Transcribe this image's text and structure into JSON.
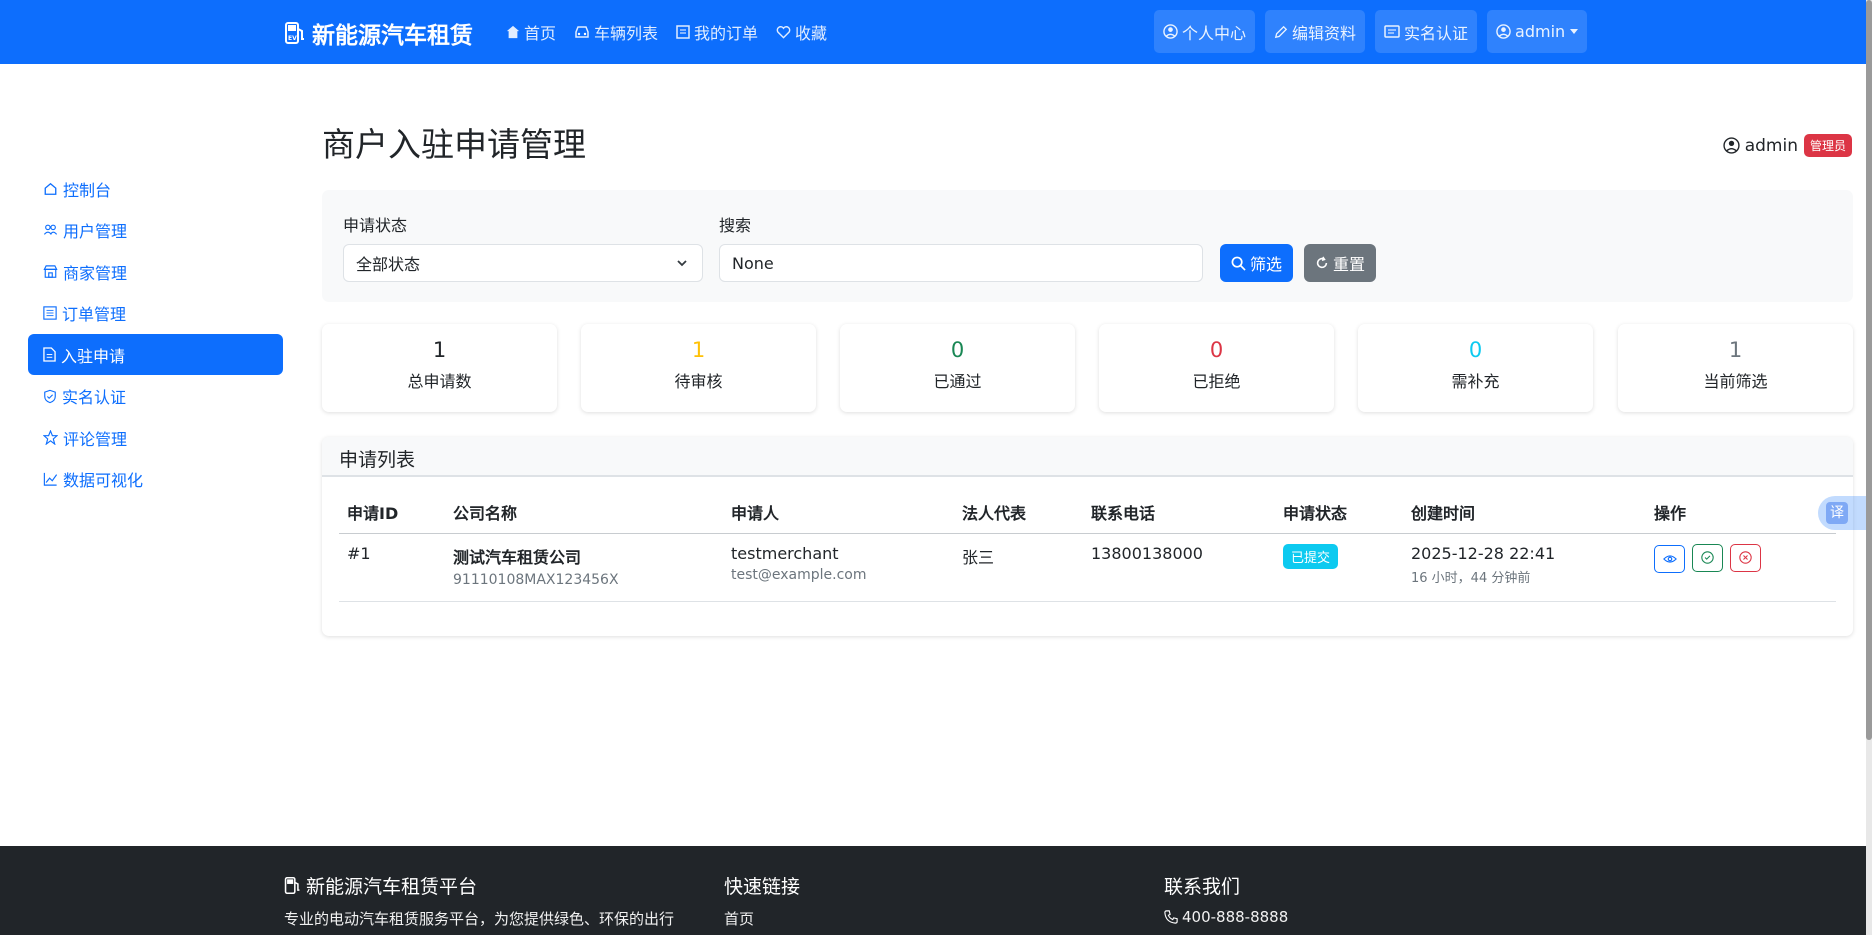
{
  "navbar": {
    "brand": "新能源汽车租赁",
    "links": [
      {
        "label": "首页",
        "icon": "house-icon"
      },
      {
        "label": "车辆列表",
        "icon": "car-icon"
      },
      {
        "label": "我的订单",
        "icon": "receipt-icon"
      },
      {
        "label": "收藏",
        "icon": "heart-icon"
      }
    ],
    "right": [
      {
        "label": "个人中心",
        "icon": "person-circle-icon"
      },
      {
        "label": "编辑资料",
        "icon": "pencil-icon"
      },
      {
        "label": "实名认证",
        "icon": "card-icon"
      }
    ],
    "user_menu": "admin"
  },
  "sidebar": {
    "items": [
      {
        "label": "控制台",
        "icon": "house-icon"
      },
      {
        "label": "用户管理",
        "icon": "people-icon"
      },
      {
        "label": "商家管理",
        "icon": "shop-icon"
      },
      {
        "label": "订单管理",
        "icon": "list-icon"
      },
      {
        "label": "入驻申请",
        "icon": "document-icon",
        "active": true
      },
      {
        "label": "实名认证",
        "icon": "shield-icon"
      },
      {
        "label": "评论管理",
        "icon": "star-icon"
      },
      {
        "label": "数据可视化",
        "icon": "chart-icon"
      }
    ]
  },
  "page": {
    "title": "商户入驻申请管理",
    "user": "admin",
    "role": "管理员"
  },
  "filters": {
    "status_label": "申请状态",
    "status_value": "全部状态",
    "search_label": "搜索",
    "search_value": "None",
    "filter_button": "筛选",
    "reset_button": "重置"
  },
  "stats": [
    {
      "value": "1",
      "label": "总申请数",
      "color": "#212529"
    },
    {
      "value": "1",
      "label": "待审核",
      "color": "#ffc107"
    },
    {
      "value": "0",
      "label": "已通过",
      "color": "#198754"
    },
    {
      "value": "0",
      "label": "已拒绝",
      "color": "#dc3545"
    },
    {
      "value": "0",
      "label": "需补充",
      "color": "#0dcaf0"
    },
    {
      "value": "1",
      "label": "当前筛选",
      "color": "#6c757d"
    }
  ],
  "list": {
    "title": "申请列表",
    "columns": [
      "申请ID",
      "公司名称",
      "申请人",
      "法人代表",
      "联系电话",
      "申请状态",
      "创建时间",
      "操作"
    ],
    "rows": [
      {
        "id": "#1",
        "company": "测试汽车租赁公司",
        "credit_code": "91110108MAX123456X",
        "applicant": "testmerchant",
        "email": "test@example.com",
        "legal_rep": "张三",
        "phone": "13800138000",
        "status": "已提交",
        "created": "2025-12-28 22:41",
        "created_ago": "16 小时，44 分钟前"
      }
    ]
  },
  "translate": "译",
  "footer": {
    "brand": "新能源汽车租赁平台",
    "desc": "专业的电动汽车租赁服务平台，为您提供绿色、环保的出行",
    "quick_links_title": "快速链接",
    "quick_link_1": "首页",
    "contact_title": "联系我们",
    "phone": "400-888-8888"
  }
}
